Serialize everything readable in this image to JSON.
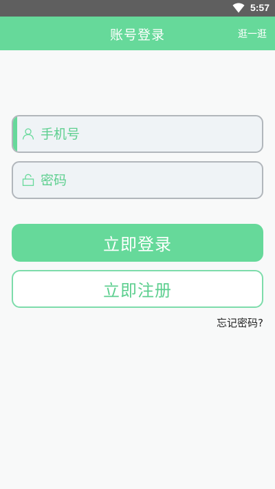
{
  "status_bar": {
    "time": "5:57",
    "wifi_icon": "wifi-icon"
  },
  "app_bar": {
    "title": "账号登录",
    "action_label": "逛一逛"
  },
  "form": {
    "phone": {
      "placeholder": "手机号",
      "value": "",
      "icon": "user-icon"
    },
    "password": {
      "placeholder": "密码",
      "value": "",
      "icon": "lock-icon"
    }
  },
  "buttons": {
    "login_label": "立即登录",
    "register_label": "立即注册"
  },
  "links": {
    "forgot_password": "忘记密码?"
  },
  "colors": {
    "primary": "#66d99a",
    "status_bar": "#5f5f5f",
    "background": "#f8f9f9",
    "field_border": "#b1b6bb",
    "field_background": "#eff3f6"
  }
}
